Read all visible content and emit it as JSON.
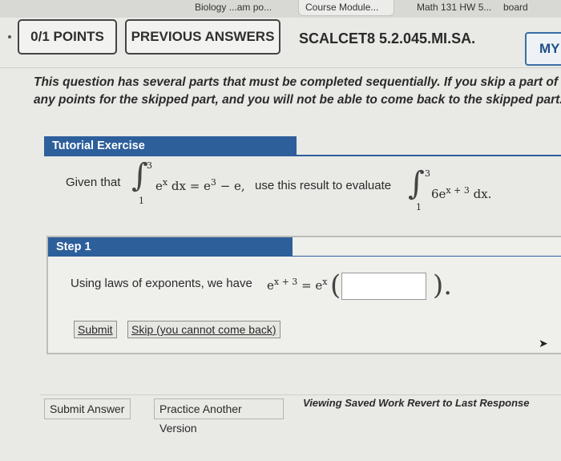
{
  "browser_tabs": [
    "Biology ...am po...",
    "Course Module...",
    "Math 131 HW 5...",
    "board"
  ],
  "header": {
    "points": "0/1 POINTS",
    "previous_answers": "PREVIOUS ANSWERS",
    "code": "SCALCET8 5.2.045.MI.SA.",
    "my_button": "MY"
  },
  "notice": {
    "line1": "This question has several parts that must be completed sequentially. If you skip a part of t",
    "line2": "any points for the skipped part, and you will not be able to come back to the skipped part."
  },
  "tutorial": {
    "title": "Tutorial Exercise",
    "given_prefix": "Given that",
    "int1_upper": "3",
    "int1_lower": "1",
    "int1_integrand": "e",
    "int1_integrand_sup": "x",
    "int1_dx": " dx = e",
    "int1_result_sup": "3",
    "int1_tail": " − e,",
    "middle_text": "use this result to evaluate",
    "int2_upper": "3",
    "int2_lower": "1",
    "int2_integrand": "6e",
    "int2_integrand_sup": "x + 3",
    "int2_dx": " dx."
  },
  "step": {
    "title": "Step 1",
    "prompt": "Using laws of exponents, we have",
    "lhs_base": "e",
    "lhs_sup": "x + 3",
    "equals": " = e",
    "rhs_sup": "x",
    "answer_value": "",
    "trailing": ").",
    "submit": "Submit",
    "skip": "Skip (you cannot come back)"
  },
  "footer": {
    "submit_answer": "Submit Answer",
    "practice": "Practice Another Version",
    "viewing": "Viewing Saved Work",
    "revert": "Revert to Last Response"
  }
}
